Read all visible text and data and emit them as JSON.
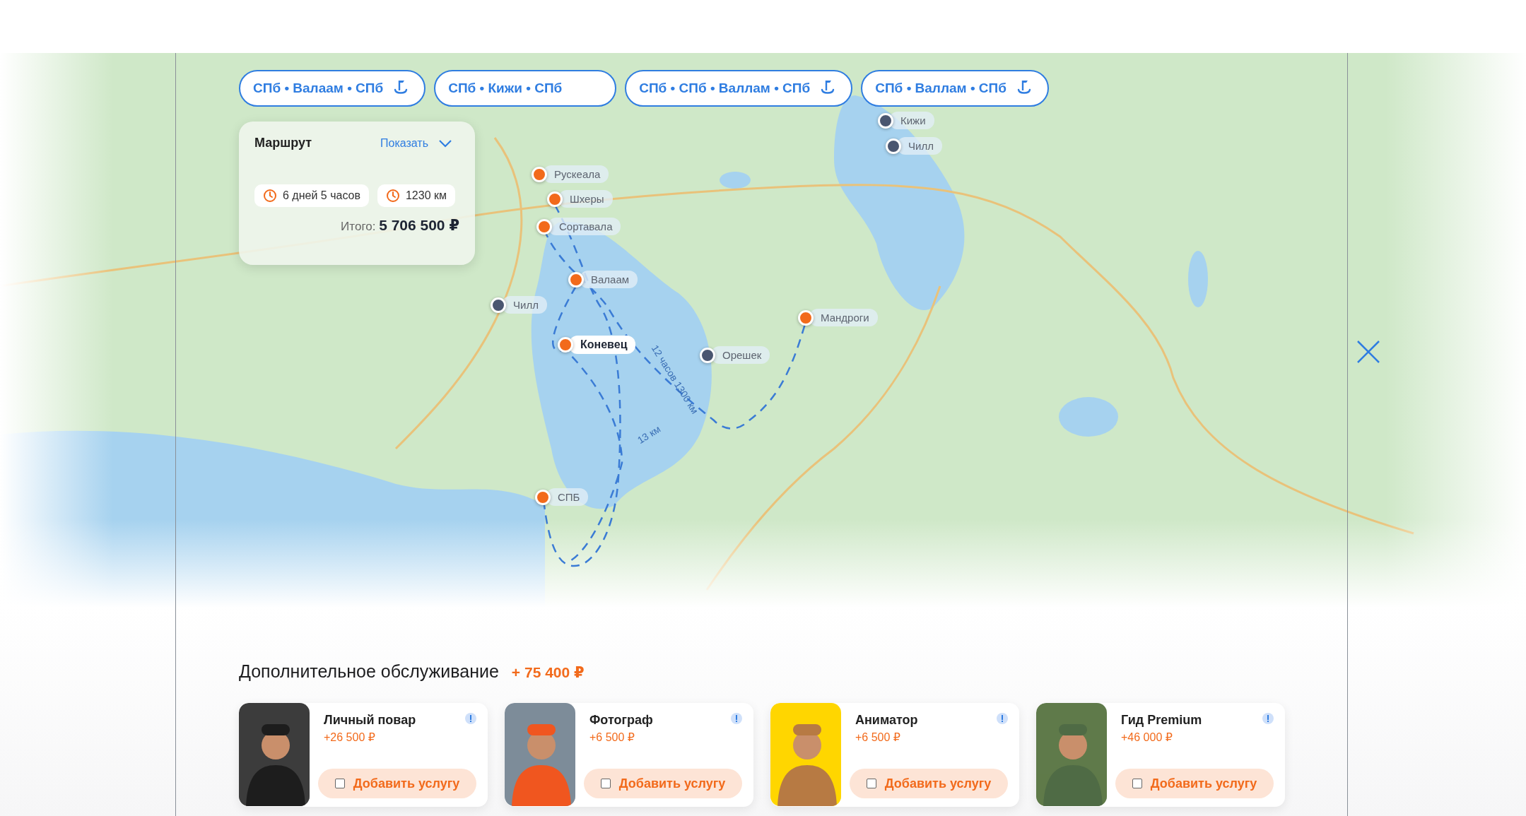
{
  "route_chips": [
    {
      "label": "СПб • Валаам • СПб",
      "has_anchor": true
    },
    {
      "label": "СПб • Кижи • СПб",
      "has_anchor": false
    },
    {
      "label": "СПб • СПб • Валлам • СПб",
      "has_anchor": true
    },
    {
      "label": "СПб • Валлам • СПб",
      "has_anchor": true
    }
  ],
  "route_card": {
    "title": "Маршрут",
    "toggle": "Показать",
    "duration": "6 дней 5 часов",
    "distance": "1230 км",
    "total_label": "Итого:",
    "total": "5 706 500 ₽"
  },
  "pins": [
    {
      "name": "Кижи",
      "color": "#4a5670",
      "selected": false
    },
    {
      "name": "Чилл",
      "color": "#4a5670",
      "selected": false
    },
    {
      "name": "Рускеала",
      "color": "#f26a1b",
      "selected": false
    },
    {
      "name": "Шхеры",
      "color": "#f26a1b",
      "selected": false
    },
    {
      "name": "Сортавала",
      "color": "#f26a1b",
      "selected": false
    },
    {
      "name": "Валаам",
      "color": "#f26a1b",
      "selected": false
    },
    {
      "name": "Чилл",
      "color": "#4a5670",
      "selected": false
    },
    {
      "name": "Коневец",
      "color": "#f26a1b",
      "selected": true
    },
    {
      "name": "Орешек",
      "color": "#4a5670",
      "selected": false
    },
    {
      "name": "Мандроги",
      "color": "#f26a1b",
      "selected": false
    },
    {
      "name": "СПБ",
      "color": "#f26a1b",
      "selected": false
    }
  ],
  "route_labels": [
    "12 часов 1300 км",
    "13 км"
  ],
  "extras": {
    "title": "Дополнительное обслуживание",
    "total": "+ 75 400 ₽",
    "services": [
      {
        "name": "Личный повар",
        "price": "+26 500 ₽",
        "button": "Добавить услугу",
        "checked": false,
        "kind": "chef"
      },
      {
        "name": "Фотограф",
        "price": "+6 500 ₽",
        "button": "Добавить услугу",
        "checked": false,
        "kind": "photographer"
      },
      {
        "name": "Аниматор",
        "price": "+6 500 ₽",
        "button": "Добавить услугу",
        "checked": false,
        "kind": "animator"
      },
      {
        "name": "Гид Premium",
        "price": "+46 000 ₽",
        "button": "Добавить услугу",
        "checked": false,
        "kind": "guide"
      }
    ]
  }
}
